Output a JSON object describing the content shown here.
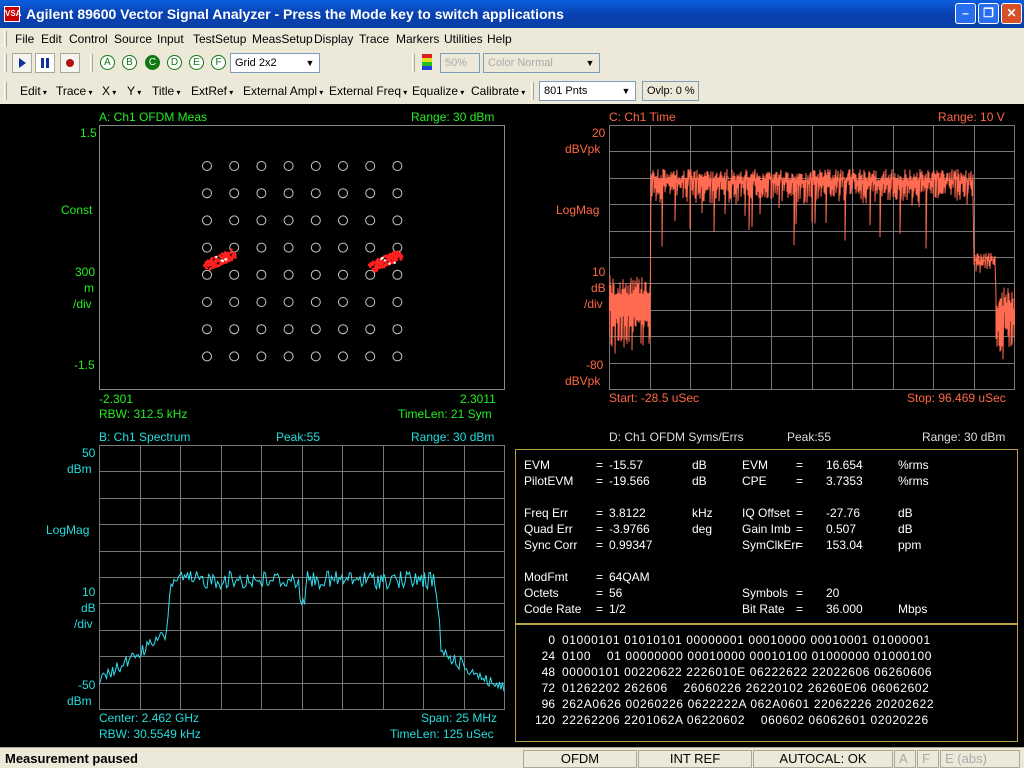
{
  "window": {
    "title": "Agilent 89600 Vector Signal Analyzer - Press the Mode key to switch applications",
    "icon_text": "VSA"
  },
  "menu": [
    "File",
    "Edit",
    "Control",
    "Source",
    "Input",
    "TestSetup",
    "MeasSetup",
    "Display",
    "Trace",
    "Markers",
    "Utilities",
    "Help"
  ],
  "toolbar1": {
    "traces": [
      "A",
      "B",
      "C",
      "D",
      "E",
      "F"
    ],
    "active_trace": "C",
    "layout": "Grid 2x2",
    "percent": "50%",
    "color": "Color Normal"
  },
  "toolbar2": {
    "menus": [
      "Edit",
      "Trace",
      "X",
      "Y",
      "Title",
      "ExtRef",
      "External Ampl",
      "External Freq",
      "Equalize",
      "Calibrate"
    ],
    "points": "801 Pnts",
    "ovlp": "Ovlp: 0 %"
  },
  "panelA": {
    "title": "A: Ch1 OFDM Meas",
    "range": "Range: 30 dBm",
    "ytop": "1.5",
    "ymid": "Const",
    "yscale": [
      "300",
      "m",
      "/div"
    ],
    "ybot": "-1.5",
    "xleft": "-2.301",
    "xright": "2.3011",
    "rbw": "RBW: 312.5 kHz",
    "timelen": "TimeLen: 21  Sym"
  },
  "panelC": {
    "title": "C: Ch1 Time",
    "range": "Range: 10  V",
    "ytop": "20",
    "ytopunit": "dBVpk",
    "ymid": "LogMag",
    "yscale": [
      "10",
      "dB",
      "/div"
    ],
    "ybot": "-80",
    "ybotunit": "dBVpk",
    "start": "Start: -28.5 uSec",
    "stop": "Stop: 96.469 uSec"
  },
  "panelB": {
    "title": "B: Ch1 Spectrum",
    "peak": "Peak:55",
    "range": "Range: 30 dBm",
    "ytop": "50",
    "ytopunit": "dBm",
    "ymid": "LogMag",
    "yscale": [
      "10",
      "dB",
      "/div"
    ],
    "ybot": "-50",
    "ybotunit": "dBm",
    "center": "Center: 2.462 GHz",
    "span": "Span: 25 MHz",
    "rbw": "RBW: 30.5549 kHz",
    "timelen": "TimeLen: 125 uSec"
  },
  "panelD": {
    "title": "D: Ch1 OFDM Syms/Errs",
    "peak": "Peak:55",
    "range": "Range: 30 dBm",
    "metrics": [
      [
        "EVM",
        "=",
        "-15.57",
        "dB",
        "EVM",
        "=",
        "16.654",
        "%rms"
      ],
      [
        "PilotEVM",
        "=",
        "-19.566",
        "dB",
        "CPE",
        "=",
        "3.7353",
        "%rms"
      ],
      [
        "",
        "",
        "",
        "",
        "",
        "",
        "",
        ""
      ],
      [
        "Freq  Err",
        "=",
        "3.8122",
        "kHz",
        "IQ  Offset",
        "=",
        "-27.76",
        "dB"
      ],
      [
        "Quad Err",
        "=",
        "-3.9766",
        "deg",
        "Gain  Imb",
        "=",
        "0.507",
        "dB"
      ],
      [
        "Sync Corr",
        "=",
        "0.99347",
        "",
        "SymClkErr",
        "=",
        "153.04",
        "ppm"
      ],
      [
        "",
        "",
        "",
        "",
        "",
        "",
        "",
        ""
      ],
      [
        "ModFmt",
        "=",
        "64QAM",
        "",
        "",
        "",
        "",
        ""
      ],
      [
        "Octets",
        "=",
        "56",
        "",
        "Symbols",
        "=",
        "20",
        ""
      ],
      [
        "Code Rate",
        "=",
        "1/2",
        "",
        "Bit   Rate",
        "=",
        "36.000",
        "Mbps"
      ]
    ],
    "bits": [
      [
        "0",
        "01000101 01010101 00000001 00010000 00010001 01000001"
      ],
      [
        "24",
        "0100    01 00000000 00010000 00010100 01000000 01000100"
      ],
      [
        "48",
        "00000101 00220622 2226010E 06222622 22022606 06260606"
      ],
      [
        "72",
        "01262202 262606    26060226 26220102 26260E06 06062602"
      ],
      [
        "96",
        "262A0626 00260226 0622222A 062A0601 22062226 20202622"
      ],
      [
        "120",
        "22262206 2201062A 06220602    060602 06062601 02020226"
      ]
    ]
  },
  "status": {
    "message": "Measurement paused",
    "mode": "OFDM",
    "ref": "INT REF",
    "autocal": "AUTOCAL: OK",
    "flags": [
      "A",
      "F",
      "E (abs)"
    ]
  },
  "colors": {
    "green": "#22ee22",
    "cyan": "#22dddd",
    "red": "#ff6644",
    "yellow": "#ffff66",
    "background": "#000000",
    "grid": "#777777"
  }
}
